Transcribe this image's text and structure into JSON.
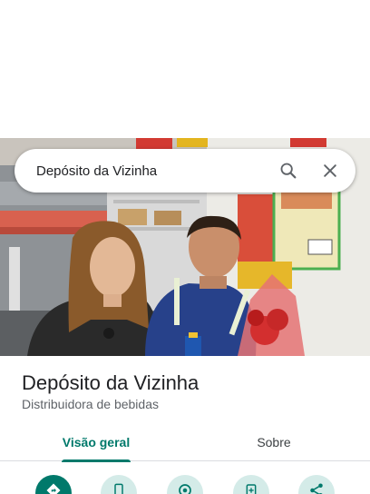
{
  "search": {
    "query": "Depósito da Vizinha"
  },
  "icons": {
    "search": "search-icon",
    "close": "close-icon"
  },
  "place": {
    "name": "Depósito da Vizinha",
    "category": "Distribuidora de bebidas"
  },
  "tabs": [
    {
      "label": "Visão geral",
      "selected": true
    },
    {
      "label": "Sobre",
      "selected": false
    }
  ],
  "actions": [
    {
      "icon": "directions-icon"
    },
    {
      "icon": "phone-icon"
    },
    {
      "icon": "location-icon"
    },
    {
      "icon": "add-photo-icon"
    },
    {
      "icon": "share-icon"
    }
  ],
  "colors": {
    "accent": "#00796b",
    "action_bg": "#d4ebe8",
    "text_secondary": "#5f6368"
  }
}
